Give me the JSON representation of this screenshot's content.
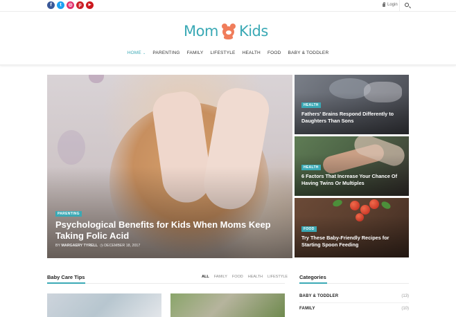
{
  "social": [
    {
      "icon": "facebook-icon",
      "glyph": "f",
      "color": "#3b5998"
    },
    {
      "icon": "twitter-icon",
      "glyph": "t",
      "color": "#1da1f2"
    },
    {
      "icon": "instagram-icon",
      "glyph": "◎",
      "color": "#e1306c"
    },
    {
      "icon": "pinterest-icon",
      "glyph": "p",
      "color": "#cb2027"
    },
    {
      "icon": "youtube-icon",
      "glyph": "▶",
      "color": "#cc181e"
    }
  ],
  "header": {
    "login_label": "Login"
  },
  "logo": {
    "word1": "Mom",
    "word2": "Kids",
    "accent": "#3aa9b5",
    "bear_color": "#f07d5b"
  },
  "nav": {
    "home": "HOME",
    "items": [
      "PARENTING",
      "FAMILY",
      "LIFESTYLE",
      "HEALTH",
      "FOOD",
      "BABY & TODDLER"
    ]
  },
  "hero": {
    "tag": "PARENTING",
    "title": "Psychological Benefits for Kids When Moms Keep Taking Folic Acid",
    "by": "BY",
    "author": "MARGAERY TYRELL",
    "date": "DECEMBER 18, 2017"
  },
  "cards": [
    {
      "tag": "HEALTH",
      "title": "Fathers' Brains Respond Differently to Daughters Than Sons"
    },
    {
      "tag": "HEALTH",
      "title": "6 Factors That Increase Your Chance Of Having Twins Or Multiples"
    },
    {
      "tag": "FOOD",
      "title": "Try These Baby-Friendly Recipes for Starting Spoon Feeding"
    }
  ],
  "baby_care": {
    "title": "Baby Care Tips",
    "filters": [
      "ALL",
      "FAMILY",
      "FOOD",
      "HEALTH",
      "LIFESTYLE"
    ]
  },
  "categories": {
    "title": "Categories",
    "items": [
      {
        "name": "BABY & TODDLER",
        "count": "(13)"
      },
      {
        "name": "FAMILY",
        "count": "(10)"
      }
    ]
  }
}
